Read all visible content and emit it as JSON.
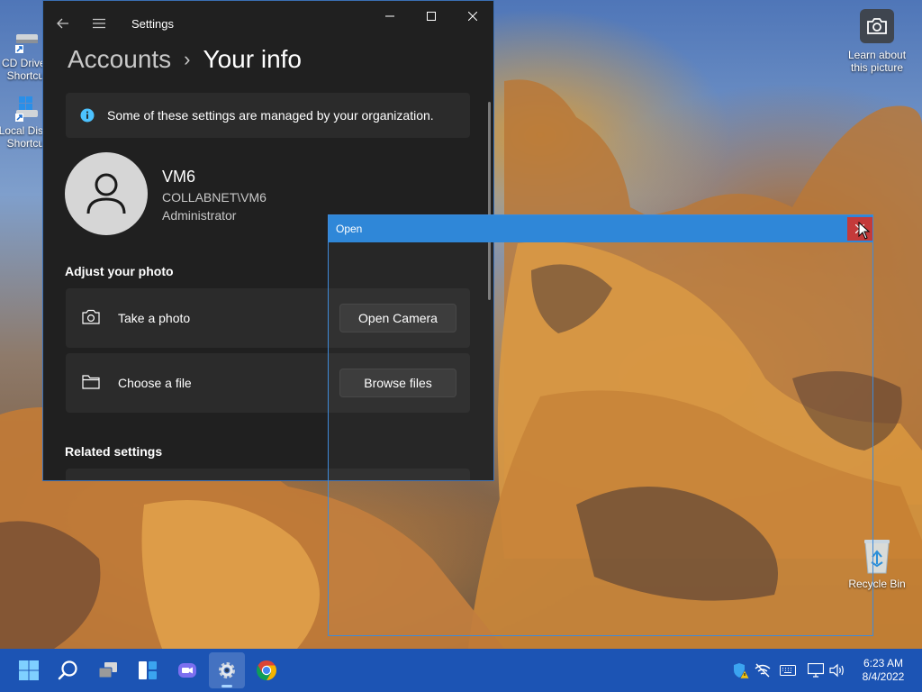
{
  "desktop": {
    "icons": {
      "cd_drive": "CD Drive - Shortcut",
      "local_disk": "Local Disk - Shortcut",
      "recycle_bin": "Recycle Bin",
      "learn": "Learn about this picture"
    }
  },
  "settings": {
    "title": "Settings",
    "breadcrumb": {
      "parent": "Accounts",
      "separator": "›",
      "current": "Your info"
    },
    "org_notice": "Some of these settings are managed by your organization.",
    "user": {
      "name": "VM6",
      "domain": "COLLABNET\\VM6",
      "role": "Administrator"
    },
    "adjust_heading": "Adjust your photo",
    "take_photo": {
      "label": "Take a photo",
      "button": "Open Camera"
    },
    "choose_file": {
      "label": "Choose a file",
      "button": "Browse files"
    },
    "related_heading": "Related settings"
  },
  "open_dialog": {
    "title": "Open"
  },
  "taskbar": {
    "items": [
      "start-icon",
      "search-icon",
      "task-view-icon",
      "widgets-icon",
      "chat-icon",
      "settings-icon",
      "chrome-icon"
    ],
    "clock": {
      "time": "6:23 AM",
      "date": "8/4/2022"
    }
  },
  "colors": {
    "taskbar": "#1c54b4",
    "settings_bg": "#202020",
    "card_bg": "#2b2b2b",
    "dialog_titlebar": "#2f87d8",
    "close_red": "#c43a3a",
    "info_blue": "#4cc2ff"
  }
}
